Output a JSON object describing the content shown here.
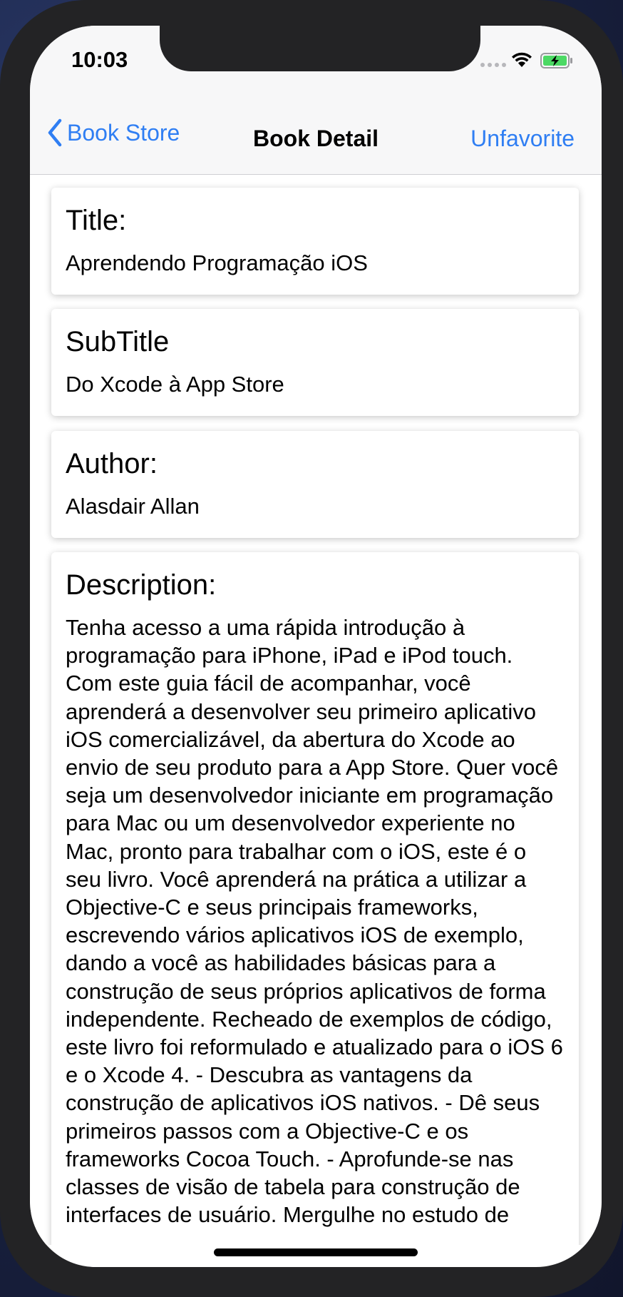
{
  "status_bar": {
    "time": "10:03"
  },
  "nav": {
    "back_label": "Book Store",
    "title": "Book Detail",
    "action_label": "Unfavorite"
  },
  "fields": {
    "title": {
      "label": "Title:",
      "value": "Aprendendo Programação iOS"
    },
    "subtitle": {
      "label": "SubTitle",
      "value": "Do Xcode à App Store"
    },
    "author": {
      "label": "Author:",
      "value": "Alasdair Allan"
    },
    "description": {
      "label": "Description:",
      "value": "Tenha acesso a uma rápida introdução à programação para iPhone, iPad e iPod touch. Com este guia fácil de acompanhar, você aprenderá a desenvolver seu primeiro aplicativo iOS comercializável, da abertura do Xcode ao envio de seu produto para a App Store. Quer você seja um desenvolvedor iniciante em programação para Mac ou um desenvolvedor experiente no Mac, pronto para trabalhar com o iOS, este é o seu livro. Você aprenderá na prática a utilizar a Objective-C e seus principais frameworks, escrevendo vários aplicativos iOS de exemplo, dando a você as habilidades básicas para a construção de seus próprios aplicativos de forma independente. Recheado de exemplos de código, este livro foi reformulado e atualizado para o iOS 6 e o Xcode 4. - Descubra as vantagens da construção de aplicativos iOS nativos. - Dê seus primeiros passos com a Objective-C e os frameworks Cocoa Touch. - Aprofunde-se nas classes de visão de tabela para construção de interfaces de usuário. Mergulhe no estudo de"
    }
  },
  "colors": {
    "accent": "#2f7ef3",
    "bar_background": "#f7f7f8",
    "bezel": "#232325"
  },
  "icons": {
    "back": "chevron-left-icon",
    "signal": "signal-icon",
    "wifi": "wifi-icon",
    "battery": "battery-charging-icon"
  }
}
